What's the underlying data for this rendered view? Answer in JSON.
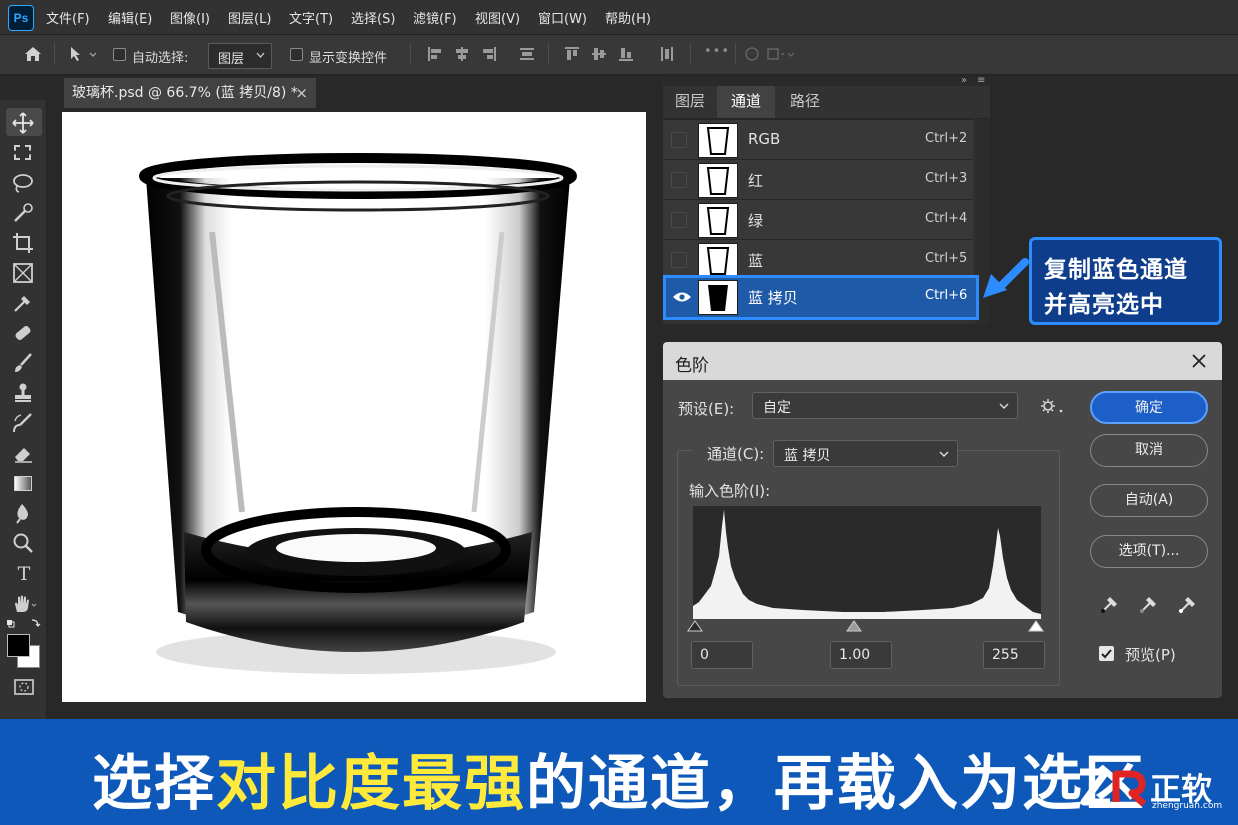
{
  "app": {
    "logo_text": "Ps"
  },
  "menu": [
    "文件(F)",
    "编辑(E)",
    "图像(I)",
    "图层(L)",
    "文字(T)",
    "选择(S)",
    "滤镜(F)",
    "视图(V)",
    "窗口(W)",
    "帮助(H)"
  ],
  "options_bar": {
    "auto_select_label": "自动选择:",
    "auto_select_value": "图层",
    "show_transform_label": "显示变换控件"
  },
  "document": {
    "tab_title": "玻璃杯.psd @ 66.7% (蓝 拷贝/8) *",
    "close_glyph": "×"
  },
  "channels_panel": {
    "tabs": [
      "图层",
      "通道",
      "路径"
    ],
    "active_tab": "通道",
    "channels": [
      {
        "name": "RGB",
        "shortcut": "Ctrl+2",
        "visible": false,
        "selected": false
      },
      {
        "name": "红",
        "shortcut": "Ctrl+3",
        "visible": false,
        "selected": false
      },
      {
        "name": "绿",
        "shortcut": "Ctrl+4",
        "visible": false,
        "selected": false
      },
      {
        "name": "蓝",
        "shortcut": "Ctrl+5",
        "visible": false,
        "selected": false
      },
      {
        "name": "蓝 拷贝",
        "shortcut": "Ctrl+6",
        "visible": true,
        "selected": true
      }
    ]
  },
  "callout": {
    "line1": "复制蓝色通道",
    "line2": "并高亮选中"
  },
  "levels_dialog": {
    "title": "色阶",
    "preset_label": "预设(E):",
    "preset_value": "自定",
    "channel_label": "通道(C):",
    "channel_value": "蓝 拷贝",
    "input_levels_label": "输入色阶(I):",
    "input_black": "0",
    "input_gamma": "1.00",
    "input_white": "255",
    "buttons": {
      "ok": "确定",
      "cancel": "取消",
      "auto": "自动(A)",
      "options": "选项(T)..."
    },
    "preview_label": "预览(P)",
    "preview_checked": true
  },
  "banner": {
    "text_before": "选择",
    "text_highlight": "对比度最强",
    "text_after": "的通道，再载入为选区"
  },
  "watermark": {
    "brand": "正软",
    "url": "zhengruan.com"
  },
  "colors": {
    "accent": "#2d8cff",
    "banner": "#0d58b8",
    "highlight": "#ffe93b"
  }
}
